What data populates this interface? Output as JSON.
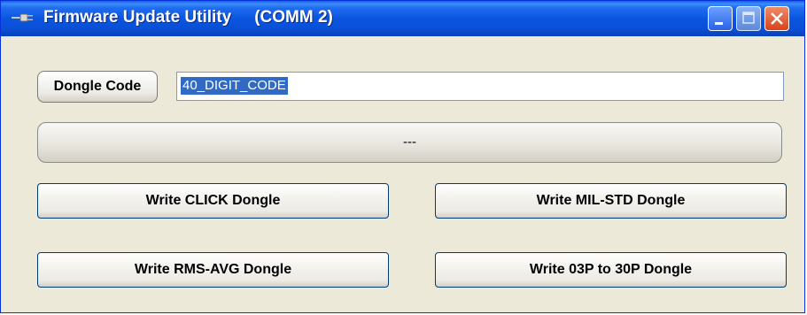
{
  "window": {
    "title": "Firmware Update Utility",
    "port": "(COMM 2)",
    "app_icon": "plug-icon",
    "controls": [
      "minimize-icon",
      "maximize-icon",
      "close-icon"
    ]
  },
  "dongle": {
    "label": "Dongle Code",
    "value": "40_DIGIT_CODE"
  },
  "status": {
    "text": "---"
  },
  "buttons": {
    "write_click": "Write CLICK Dongle",
    "write_mil": "Write MIL-STD Dongle",
    "write_rms": "Write RMS-AVG Dongle",
    "write_03p": "Write 03P to 30P Dongle"
  },
  "colors": {
    "titlebar": "#0a55e0",
    "dialog_bg": "#ece9d8",
    "selection": "#316ac5",
    "close_button": "#d9421a"
  }
}
